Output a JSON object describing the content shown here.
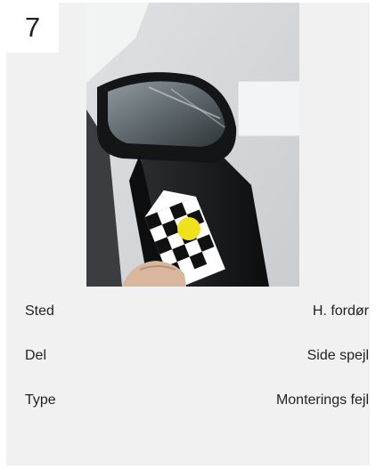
{
  "card": {
    "number": "7",
    "photo": {
      "icon": "car-side-mirror-damage-photo",
      "colors": {
        "mirror": "#151515",
        "marker": "#f0e11f",
        "wall": "#e8eaeb"
      }
    },
    "details": [
      {
        "label": "Sted",
        "value": "H. fordør"
      },
      {
        "label": "Del",
        "value": "Side spejl"
      },
      {
        "label": "Type",
        "value": "Monterings fejl"
      }
    ]
  }
}
